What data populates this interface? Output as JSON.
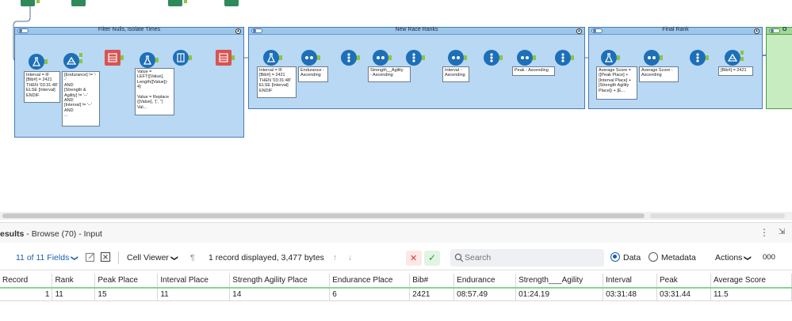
{
  "containers": [
    {
      "title": "Filter Nulls, Isolate Times",
      "collapse_glyph": "▲"
    },
    {
      "title": "New Race Ranks",
      "collapse_glyph": "▲"
    },
    {
      "title": "Final Rank",
      "collapse_glyph": "▲"
    },
    {
      "title": "O",
      "collapse_glyph": ""
    }
  ],
  "annotations": {
    "interval_formula_1": "Interval = IF\n[Bib#] = 2421\nTHEN '03:31:48'\nELSE [Interval]\nENDIF",
    "filter_expression": "[Endurance] != '-\n-'\nAND\n[Strength &\nAgility] != '--'\nAND\n[Interval] != '--'\nAND\n...",
    "value_formula": "Value =\nLEFT([Value],\nLength([Value])-\n4)\n\nValue = Replace\n([Value], '(', '')\nVal...",
    "interval_formula_2": "Interval = IF\n[Bib#] = 2421\nTHEN '03:31:48'\nELSE [Interval]\nENDIF",
    "endurance_sort": "Endurance -\nAscending",
    "strength_sort": "Strength__Agility\n- Ascending",
    "interval_sort": "Interval -\nAscending",
    "peak_sort": "Peak - Ascending",
    "average_formula": "Average Score =\n([Peak Place] +\n[Interval Place] +\n[Strength Agility\nPlace]) + [E...",
    "average_sort": "Average Score -\nAscending",
    "bib_filter": "[Bib#] = 2421"
  },
  "results": {
    "title_prefix": "esults",
    "title_rest": " - Browse (70) - Input",
    "menu_glyph": "⋮",
    "pin_glyph": "⇲"
  },
  "toolbar": {
    "fields_label": "11 of 11 Fields",
    "fields_chevron": "❯",
    "cell_viewer_label": "Cell Viewer",
    "cell_viewer_chevron": "❯",
    "pilcrow": "¶",
    "records_info": "1 record displayed, 3,477 bytes",
    "up_arrow": "↑",
    "down_arrow": "↓",
    "cancel_glyph": "✕",
    "confirm_glyph": "✓",
    "search_placeholder": "Search",
    "data_label": "Data",
    "metadata_label": "Metadata",
    "actions_label": "Actions",
    "actions_chevron": "❯",
    "more_label": "000"
  },
  "table": {
    "columns": [
      "Record",
      "Rank",
      "Peak Place",
      "Interval Place",
      "Strength Agility Place",
      "Endurance Place",
      "Bib#",
      "Endurance",
      "Strength___Agility",
      "Interval",
      "Peak",
      "Average Score"
    ],
    "rows": [
      [
        "1",
        "11",
        "15",
        "11",
        "14",
        "6",
        "2421",
        "08:57.49",
        "01:24.19",
        "03:31:48",
        "03:31.44",
        "11.5"
      ]
    ]
  },
  "colors": {
    "container_fill": "#b8d8f4",
    "container_border": "#4a7ab5",
    "anchor_green": "#8cc63f",
    "tool_blue": "#1d6fb8",
    "tool_red": "#d9534f",
    "accent_blue": "#1a5eb0"
  }
}
